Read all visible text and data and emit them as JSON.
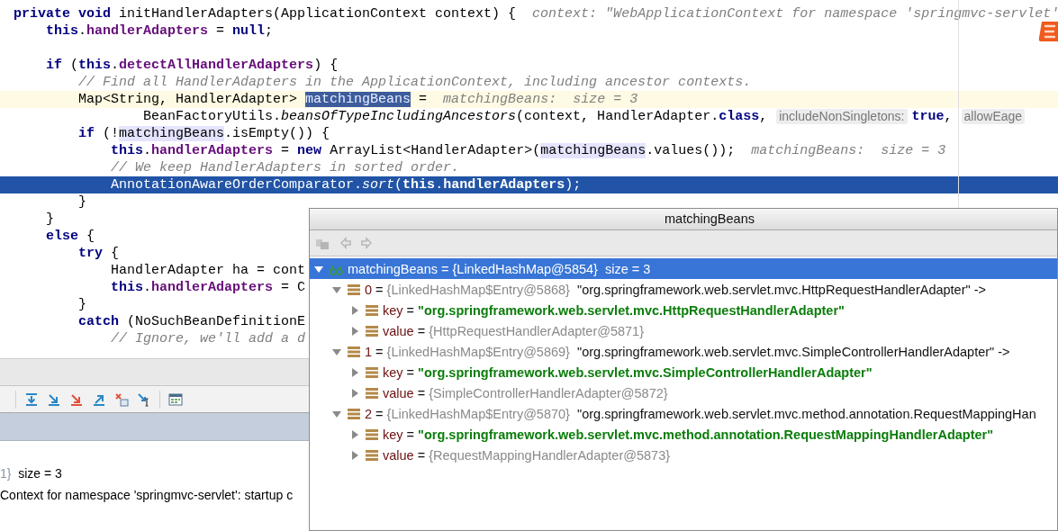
{
  "editor": {
    "lines": [
      {
        "caret_line": false,
        "execution_point": false,
        "parts": [
          {
            "kind": "code",
            "tokens": [
              {
                "kind": "keyword",
                "text": "private void"
              },
              {
                "kind": "plain",
                "text": " initHandlerAdapters(ApplicationContext context) {"
              }
            ]
          },
          {
            "kind": "hint",
            "text": "context: \"WebApplicationContext for namespace 'springmvc-servlet'"
          }
        ]
      },
      {
        "caret_line": false,
        "execution_point": false,
        "parts": [
          {
            "kind": "code",
            "tokens": [
              {
                "kind": "keyword",
                "text": "    this"
              },
              {
                "kind": "plain",
                "text": "."
              },
              {
                "kind": "field",
                "text": "handlerAdapters"
              },
              {
                "kind": "plain",
                "text": " = "
              },
              {
                "kind": "keyword",
                "text": "null"
              },
              {
                "kind": "plain",
                "text": ";"
              }
            ]
          }
        ]
      },
      {
        "caret_line": false,
        "execution_point": false
      },
      {
        "caret_line": false,
        "execution_point": false,
        "parts": [
          {
            "kind": "code",
            "tokens": [
              {
                "kind": "keyword",
                "text": "    if"
              },
              {
                "kind": "plain",
                "text": " ("
              },
              {
                "kind": "keyword",
                "text": "this"
              },
              {
                "kind": "plain",
                "text": "."
              },
              {
                "kind": "field",
                "text": "detectAllHandlerAdapters"
              },
              {
                "kind": "plain",
                "text": ") {"
              }
            ]
          }
        ]
      },
      {
        "caret_line": false,
        "execution_point": false,
        "parts": [
          {
            "kind": "code",
            "tokens": [
              {
                "kind": "comment",
                "text": "        // Find all HandlerAdapters in the ApplicationContext, including ancestor contexts."
              }
            ]
          }
        ]
      },
      {
        "caret_line": true,
        "execution_point": false,
        "parts": [
          {
            "kind": "code",
            "tokens": [
              {
                "kind": "plain",
                "text": "        Map<String, HandlerAdapter> "
              },
              {
                "kind": "selected-usage",
                "text": "matchingBeans"
              },
              {
                "kind": "plain",
                "text": " ="
              }
            ]
          },
          {
            "kind": "hint",
            "text": "matchingBeans:  size = 3"
          }
        ]
      },
      {
        "caret_line": false,
        "execution_point": false,
        "parts": [
          {
            "kind": "code",
            "tokens": [
              {
                "kind": "plain",
                "text": "                BeanFactoryUtils."
              },
              {
                "kind": "static",
                "text": "beansOfTypeIncludingAncestors"
              },
              {
                "kind": "plain",
                "text": "(context, HandlerAdapter."
              },
              {
                "kind": "keyword",
                "text": "class"
              },
              {
                "kind": "plain",
                "text": ","
              }
            ]
          },
          {
            "kind": "param",
            "text": "includeNonSingletons:"
          },
          {
            "kind": "code",
            "tokens": [
              {
                "kind": "keyword",
                "text": "true"
              },
              {
                "kind": "plain",
                "text": ","
              }
            ]
          },
          {
            "kind": "param",
            "text": "allowEage"
          }
        ]
      },
      {
        "caret_line": false,
        "execution_point": false,
        "parts": [
          {
            "kind": "code",
            "tokens": [
              {
                "kind": "keyword",
                "text": "        if"
              },
              {
                "kind": "plain",
                "text": " (!"
              },
              {
                "kind": "usage",
                "text": "matchingBeans"
              },
              {
                "kind": "plain",
                "text": ".isEmpty()) {"
              }
            ]
          }
        ]
      },
      {
        "caret_line": false,
        "execution_point": false,
        "parts": [
          {
            "kind": "code",
            "tokens": [
              {
                "kind": "keyword",
                "text": "            this"
              },
              {
                "kind": "plain",
                "text": "."
              },
              {
                "kind": "field",
                "text": "handlerAdapters"
              },
              {
                "kind": "plain",
                "text": " = "
              },
              {
                "kind": "keyword",
                "text": "new"
              },
              {
                "kind": "plain",
                "text": " ArrayList<HandlerAdapter>("
              },
              {
                "kind": "usage",
                "text": "matchingBeans"
              },
              {
                "kind": "plain",
                "text": ".values());"
              }
            ]
          },
          {
            "kind": "hint",
            "text": "matchingBeans:  size = 3"
          }
        ]
      },
      {
        "caret_line": false,
        "execution_point": false,
        "parts": [
          {
            "kind": "code",
            "tokens": [
              {
                "kind": "comment",
                "text": "            // We keep HandlerAdapters in sorted order."
              }
            ]
          }
        ]
      },
      {
        "caret_line": false,
        "execution_point": true,
        "parts": [
          {
            "kind": "code",
            "tokens": [
              {
                "kind": "plain",
                "text": "            AnnotationAwareOrderComparator."
              },
              {
                "kind": "static",
                "text": "sort"
              },
              {
                "kind": "plain",
                "text": "("
              },
              {
                "kind": "keyword",
                "text": "this"
              },
              {
                "kind": "plain",
                "text": "."
              },
              {
                "kind": "field",
                "text": "handlerAdapters"
              },
              {
                "kind": "plain",
                "text": ");"
              }
            ]
          }
        ]
      },
      {
        "caret_line": false,
        "execution_point": false,
        "parts": [
          {
            "kind": "code",
            "tokens": [
              {
                "kind": "plain",
                "text": "        }"
              }
            ]
          }
        ]
      },
      {
        "caret_line": false,
        "execution_point": false,
        "parts": [
          {
            "kind": "code",
            "tokens": [
              {
                "kind": "plain",
                "text": "    }"
              }
            ]
          }
        ]
      },
      {
        "caret_line": false,
        "execution_point": false,
        "parts": [
          {
            "kind": "code",
            "tokens": [
              {
                "kind": "keyword",
                "text": "    else"
              },
              {
                "kind": "plain",
                "text": " {"
              }
            ]
          }
        ]
      },
      {
        "caret_line": false,
        "execution_point": false,
        "parts": [
          {
            "kind": "code",
            "tokens": [
              {
                "kind": "keyword",
                "text": "        try"
              },
              {
                "kind": "plain",
                "text": " {"
              }
            ]
          }
        ]
      },
      {
        "caret_line": false,
        "execution_point": false,
        "parts": [
          {
            "kind": "code",
            "tokens": [
              {
                "kind": "plain",
                "text": "            HandlerAdapter ha = cont"
              }
            ]
          }
        ]
      },
      {
        "caret_line": false,
        "execution_point": false,
        "parts": [
          {
            "kind": "code",
            "tokens": [
              {
                "kind": "keyword",
                "text": "            this"
              },
              {
                "kind": "plain",
                "text": "."
              },
              {
                "kind": "field",
                "text": "handlerAdapters"
              },
              {
                "kind": "plain",
                "text": " = C"
              }
            ]
          }
        ]
      },
      {
        "caret_line": false,
        "execution_point": false,
        "parts": [
          {
            "kind": "code",
            "tokens": [
              {
                "kind": "plain",
                "text": "        }"
              }
            ]
          }
        ]
      },
      {
        "caret_line": false,
        "execution_point": false,
        "parts": [
          {
            "kind": "code",
            "tokens": [
              {
                "kind": "keyword",
                "text": "        catch"
              },
              {
                "kind": "plain",
                "text": " (NoSuchBeanDefinitionE"
              }
            ]
          }
        ]
      },
      {
        "caret_line": false,
        "execution_point": false,
        "parts": [
          {
            "kind": "code",
            "tokens": [
              {
                "kind": "comment",
                "text": "            // Ignore, we'll add a d"
              }
            ]
          }
        ]
      }
    ]
  },
  "debugger": {
    "variables": [
      {
        "ref": "1}",
        "detail": "size = 3"
      },
      {
        "detail": "Context for namespace 'springmvc-servlet': startup c"
      }
    ]
  },
  "popup": {
    "title": "matchingBeans",
    "tree": [
      {
        "name": "matchingBeans",
        "sep": "=",
        "ref": "{LinkedHashMap@5854}",
        "detail": "size = 3",
        "kind": "watch",
        "expanded": true,
        "selected": true,
        "children": [
          {
            "name": "0",
            "sep": "=",
            "ref": "{LinkedHashMap$Entry@5868}",
            "detail": "\"org.springframework.web.servlet.mvc.HttpRequestHandlerAdapter\" ->",
            "kind": "field",
            "expanded": true,
            "selected": false,
            "children": [
              {
                "name": "key",
                "sep": "=",
                "string": "\"org.springframework.web.servlet.mvc.HttpRequestHandlerAdapter\"",
                "kind": "field",
                "expanded": false,
                "selected": false
              },
              {
                "name": "value",
                "sep": "=",
                "ref": "{HttpRequestHandlerAdapter@5871}",
                "kind": "field",
                "expanded": false,
                "selected": false
              }
            ]
          },
          {
            "name": "1",
            "sep": "=",
            "ref": "{LinkedHashMap$Entry@5869}",
            "detail": "\"org.springframework.web.servlet.mvc.SimpleControllerHandlerAdapter\" ->",
            "kind": "field",
            "expanded": true,
            "selected": false,
            "children": [
              {
                "name": "key",
                "sep": "=",
                "string": "\"org.springframework.web.servlet.mvc.SimpleControllerHandlerAdapter\"",
                "kind": "field",
                "expanded": false,
                "selected": false
              },
              {
                "name": "value",
                "sep": "=",
                "ref": "{SimpleControllerHandlerAdapter@5872}",
                "kind": "field",
                "expanded": false,
                "selected": false
              }
            ]
          },
          {
            "name": "2",
            "sep": "=",
            "ref": "{LinkedHashMap$Entry@5870}",
            "detail": "\"org.springframework.web.servlet.mvc.method.annotation.RequestMappingHan",
            "kind": "field",
            "expanded": true,
            "selected": false,
            "children": [
              {
                "name": "key",
                "sep": "=",
                "string": "\"org.springframework.web.servlet.mvc.method.annotation.RequestMappingHandlerAdapter\"",
                "kind": "field",
                "expanded": false,
                "selected": false
              },
              {
                "name": "value",
                "sep": "=",
                "ref": "{RequestMappingHandlerAdapter@5873}",
                "kind": "field",
                "expanded": false,
                "selected": false
              }
            ]
          }
        ]
      }
    ]
  }
}
